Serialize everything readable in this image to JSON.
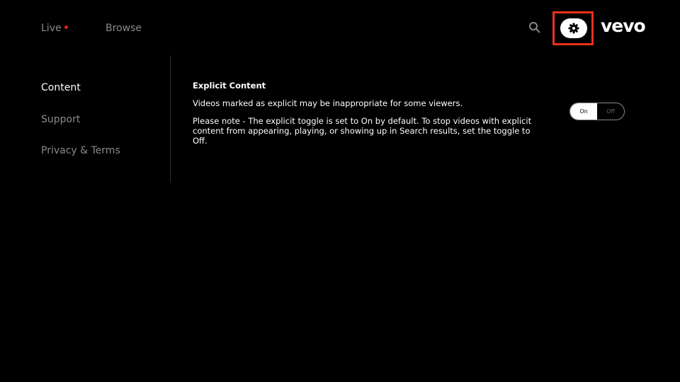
{
  "nav": {
    "live": "Live",
    "browse": "Browse"
  },
  "header": {
    "logo": "vevo",
    "search_icon": "search-icon",
    "settings_icon": "gear-icon"
  },
  "sidebar": {
    "items": [
      {
        "label": "Content"
      },
      {
        "label": "Support"
      },
      {
        "label": "Privacy & Terms"
      }
    ]
  },
  "content": {
    "title": "Explicit Content",
    "description": "Videos marked as explicit may be inappropriate for some viewers.",
    "note": "Please note - The explicit toggle is set to On by default. To stop videos with explicit content from appearing, playing, or showing up in Search results, set the toggle to Off.",
    "toggle": {
      "on": "On",
      "off": "Off",
      "selected": "On"
    }
  },
  "colors": {
    "accent": "#e0201c",
    "highlight": "#e8311a"
  }
}
